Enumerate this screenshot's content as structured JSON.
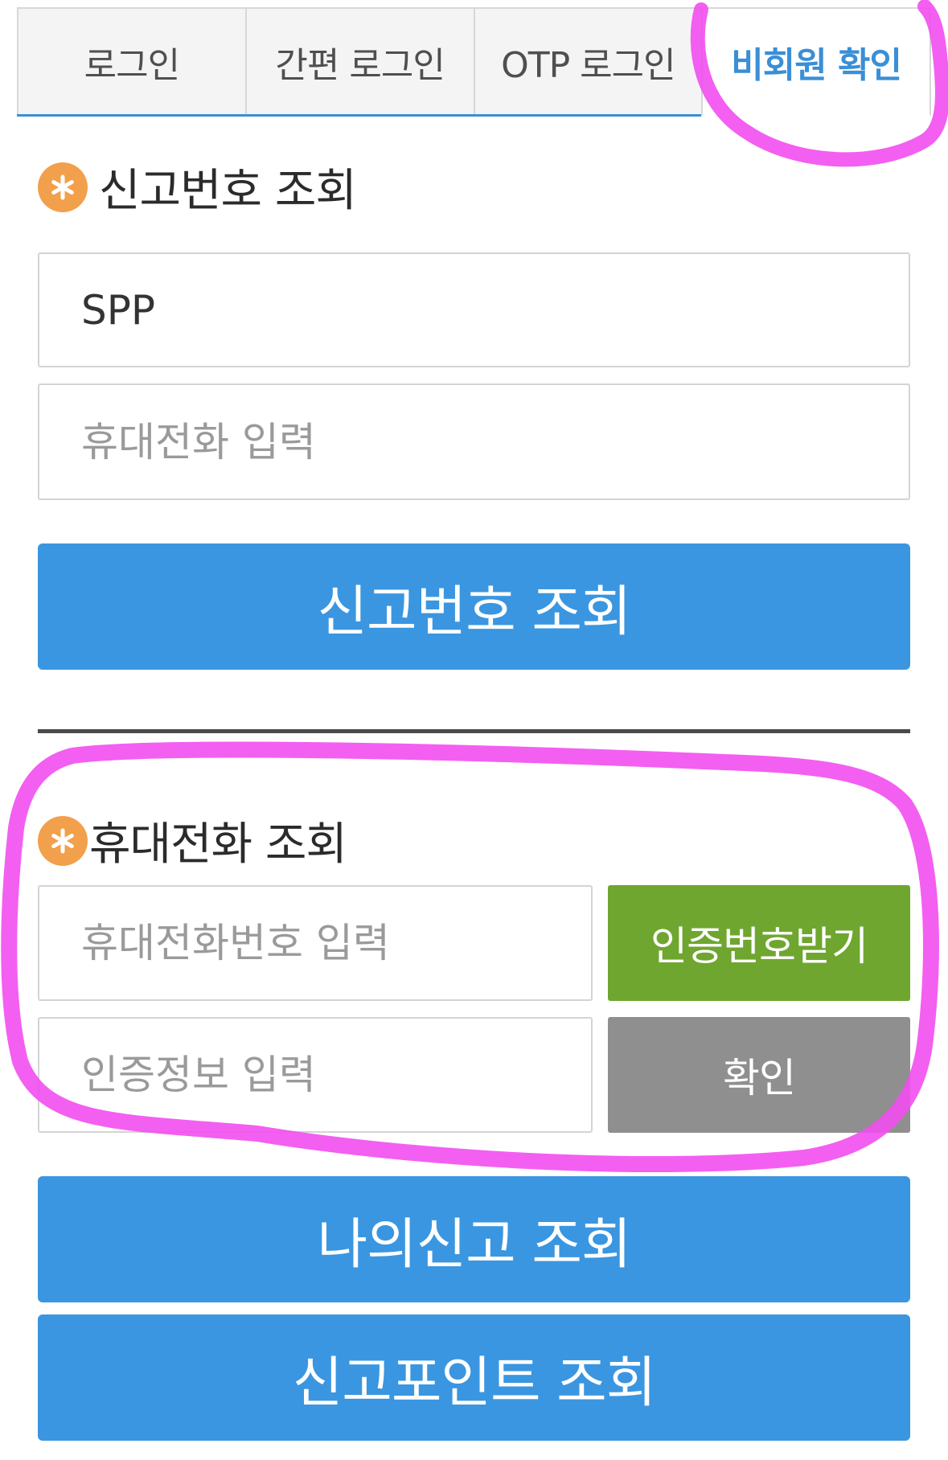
{
  "tabs": [
    {
      "label": "로그인",
      "active": false
    },
    {
      "label": "간편 로그인",
      "active": false
    },
    {
      "label": "OTP 로그인",
      "active": false
    },
    {
      "label": "비회원 확인",
      "active": true
    }
  ],
  "report_lookup": {
    "heading": "신고번호 조회",
    "report_number_value": "SPP",
    "phone_placeholder": "휴대전화 입력",
    "submit_label": "신고번호 조회"
  },
  "phone_lookup": {
    "heading": "휴대전화 조회",
    "phone_placeholder": "휴대전화번호 입력",
    "request_code_label": "인증번호받기",
    "code_placeholder": "인증정보 입력",
    "confirm_label": "확인"
  },
  "actions": {
    "my_reports_label": "나의신고 조회",
    "report_points_label": "신고포인트 조회"
  },
  "colors": {
    "accent_blue": "#3a96e0",
    "tab_active_text": "#3a8fd6",
    "green_button": "#6fa62f",
    "gray_button": "#8f8f8f",
    "star_badge": "#f2a04b",
    "annotation_magenta": "#f24ef0"
  }
}
